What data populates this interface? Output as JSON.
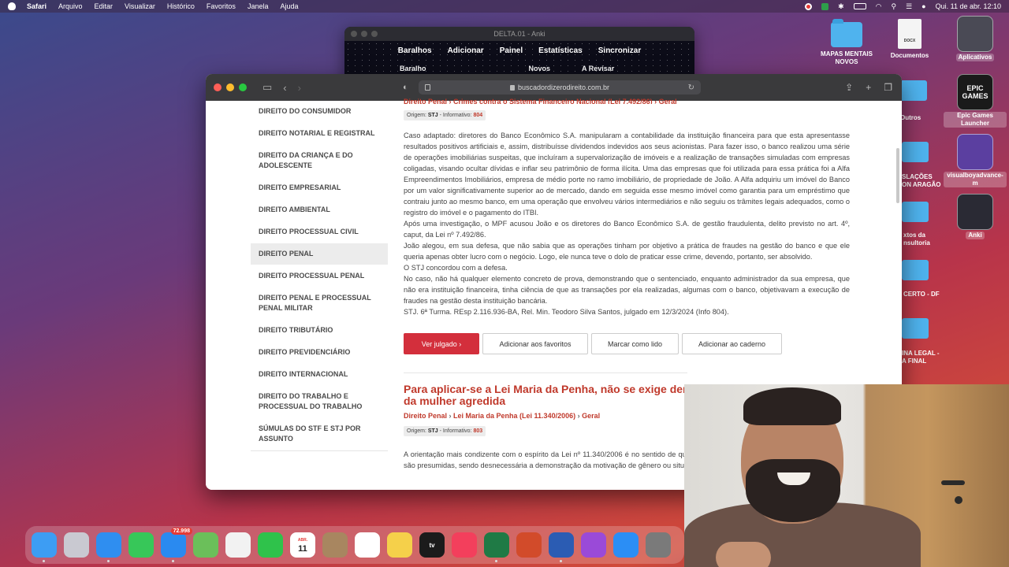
{
  "menubar": {
    "app": "Safari",
    "items": [
      "Arquivo",
      "Editar",
      "Visualizar",
      "Histórico",
      "Favoritos",
      "Janela",
      "Ajuda"
    ],
    "clock": "Qui. 11 de abr.  12:10"
  },
  "desktop": {
    "icons": [
      {
        "label": "MAPAS MENTAIS NOVOS",
        "icon": "folder-icon"
      },
      {
        "label": "Documentos",
        "icon": "document-icon",
        "doc_text": "DOCX"
      },
      {
        "label": "Aplicativos",
        "icon": "app-window-icon"
      },
      {
        "label": "Epic Games Launcher",
        "icon": "epic-games-icon",
        "app_text": "EPIC GAMES"
      },
      {
        "label": "visualboyadvance-m",
        "icon": "gameboy-icon"
      },
      {
        "label": "Anki",
        "icon": "anki-icon"
      }
    ],
    "partial_labels": [
      "Outros",
      "SLAÇÕES\nON ARAGÃO",
      "xtos da\nnsultoria",
      "CERTO - DF",
      "INA LEGAL -\nA FINAL"
    ]
  },
  "anki": {
    "title": "DELTA.01 - Anki",
    "nav": [
      "Baralhos",
      "Adicionar",
      "Painel",
      "Estatísticas",
      "Sincronizar"
    ],
    "subnav": [
      "Baralho",
      "Novos",
      "A Revisar"
    ]
  },
  "safari": {
    "url": "buscadordizerodireito.com.br",
    "sidebar": [
      "DIREITO DO CONSUMIDOR",
      "DIREITO NOTARIAL E REGISTRAL",
      "DIREITO DA CRIANÇA E DO ADOLESCENTE",
      "DIREITO EMPRESARIAL",
      "DIREITO AMBIENTAL",
      "DIREITO PROCESSUAL CIVIL",
      "DIREITO PENAL",
      "DIREITO PROCESSUAL PENAL",
      "DIREITO PENAL E PROCESSUAL PENAL MILITAR",
      "DIREITO TRIBUTÁRIO",
      "DIREITO PREVIDENCIÁRIO",
      "DIREITO INTERNACIONAL",
      "DIREITO DO TRABALHO E PROCESSUAL DO TRABALHO",
      "SÚMULAS DO STF E STJ POR ASSUNTO"
    ],
    "active_sidebar": "DIREITO PENAL",
    "article1": {
      "crumb": "Direito Penal › Crimes contra o Sistema Financeiro Nacional (Lei 7.492/86) › Geral",
      "origin_label": "Origem:",
      "origin_court": "STJ",
      "origin_sep": "- Informativo:",
      "origin_num": "804",
      "paragraphs": [
        "Caso adaptado: diretores do Banco Econômico S.A. manipularam a contabilidade da instituição financeira para que esta apresentasse resultados positivos artificiais e, assim, distribuísse dividendos indevidos aos seus acionistas. Para fazer isso, o banco realizou uma série de operações imobiliárias suspeitas, que incluíram a supervalorização de imóveis e a realização de transações simuladas com empresas coligadas, visando ocultar dívidas e inflar seu patrimônio de forma ilícita. Uma das empresas que foi utilizada para essa prática foi a Alfa Empreendimentos Imobiliários, empresa de médio porte no ramo imobiliário, de propriedade de João. A Alfa adquiriu um imóvel do Banco por um valor significativamente superior ao de mercado, dando em seguida esse mesmo imóvel como garantia para um empréstimo que contraiu junto ao mesmo banco, em uma operação que envolveu vários intermediários e não seguiu os trâmites legais adequados, como o registro do imóvel e o pagamento do ITBI.",
        "Após uma investigação, o MPF acusou João e os diretores do Banco Econômico S.A. de gestão fraudulenta, delito previsto no art. 4º, caput, da Lei nº 7.492/86.",
        "João alegou, em sua defesa, que não sabia que as operações tinham por objetivo a prática de fraudes na gestão do banco e que ele queria apenas obter lucro com o negócio. Logo, ele nunca teve o dolo de praticar esse crime, devendo, portanto, ser absolvido.",
        "O STJ concordou com a defesa.",
        "No caso, não há qualquer elemento concreto de prova, demonstrando que o sentenciado, enquanto administrador da sua empresa, que não era instituição financeira, tinha ciência de que as transações por ela realizadas, algumas com o banco, objetivavam a execução de fraudes na gestão desta instituição bancária.",
        "STJ. 6ª Turma. REsp 2.116.936-BA, Rel. Min. Teodoro Silva Santos, julgado em 12/3/2024 (Info 804)."
      ],
      "buttons": {
        "ver": "Ver julgado",
        "fav": "Adicionar aos favoritos",
        "lido": "Marcar como lido",
        "caderno": "Adicionar ao caderno"
      }
    },
    "article2": {
      "title": "Para aplicar-se a Lei Maria da Penha, não se exige demonstração de vulnerabilidade da mulher agredida",
      "crumb_a": "Direito Penal",
      "crumb_b": "Lei Maria da Penha (Lei 11.340/2006)",
      "crumb_c": "Geral",
      "origin_label": "Origem:",
      "origin_court": "STJ",
      "origin_sep": "- Informativo:",
      "origin_num": "803",
      "text": "A orientação mais condizente com o espírito da Lei nº 11.340/2006 é no sentido de que a hipossuficiência e a vulnerabilidade da mulher são presumidas, sendo desnecessária a demonstração da motivação de gênero ou situação de vulnerabilidade."
    }
  },
  "dock": {
    "apps": [
      {
        "name": "finder-icon",
        "color": "#3d9df3"
      },
      {
        "name": "launchpad-icon",
        "color": "#c9c9d1"
      },
      {
        "name": "safari-icon",
        "color": "#2f8ef0"
      },
      {
        "name": "messages-icon",
        "color": "#37c759"
      },
      {
        "name": "mail-icon",
        "color": "#2a8af0",
        "badge": "72.998"
      },
      {
        "name": "maps-icon",
        "color": "#6bbf5a"
      },
      {
        "name": "photos-icon",
        "color": "#f2f2f2"
      },
      {
        "name": "facetime-icon",
        "color": "#2fc24b"
      },
      {
        "name": "calendar-icon",
        "color": "#ffffff",
        "text": "11"
      },
      {
        "name": "contacts-icon",
        "color": "#a88660"
      },
      {
        "name": "reminders-icon",
        "color": "#ffffff"
      },
      {
        "name": "notes-icon",
        "color": "#f5d04a"
      },
      {
        "name": "tv-icon",
        "color": "#1b1b1b",
        "text": "tv"
      },
      {
        "name": "music-icon",
        "color": "#f33f5c"
      },
      {
        "name": "excel-icon",
        "color": "#1f7a45"
      },
      {
        "name": "powerpoint-icon",
        "color": "#d24b2a"
      },
      {
        "name": "word-icon",
        "color": "#2b5cb3"
      },
      {
        "name": "podcasts-icon",
        "color": "#9a4ad8"
      },
      {
        "name": "appstore-icon",
        "color": "#2b8ef5"
      },
      {
        "name": "system-settings-icon",
        "color": "#7a7a7a"
      }
    ],
    "calendar_month": "ABR."
  }
}
